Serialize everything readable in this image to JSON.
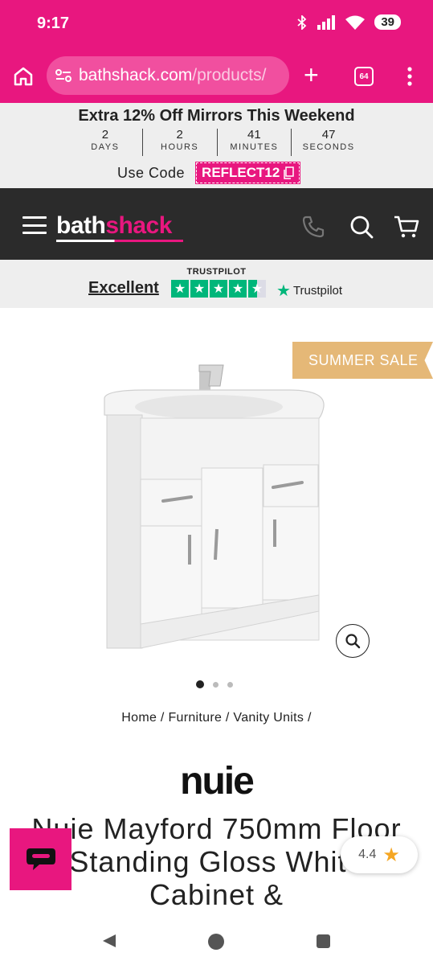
{
  "status_bar": {
    "time": "9:17",
    "battery": "39"
  },
  "browser": {
    "url_domain": "bathshack.com",
    "url_path": "/products/",
    "tab_count": "64"
  },
  "promo": {
    "title": "Extra 12% Off Mirrors This Weekend",
    "countdown": [
      {
        "value": "2",
        "label": "DAYS"
      },
      {
        "value": "2",
        "label": "HOURS"
      },
      {
        "value": "41",
        "label": "MINUTES"
      },
      {
        "value": "47",
        "label": "SECONDS"
      }
    ],
    "code_label": "Use Code",
    "code": "REFLECT12"
  },
  "header": {
    "logo_part1": "bath",
    "logo_part2": "shack"
  },
  "trustpilot": {
    "heading": "TRUSTPILOT",
    "rating_text": "Excellent",
    "brand": "Trustpilot",
    "stars": 4.5
  },
  "product": {
    "badge": "SUMMER SALE",
    "image_count": 3,
    "active_image": 1,
    "breadcrumb": [
      "Home",
      "Furniture",
      "Vanity Units"
    ],
    "brand": "nuie",
    "title": "Nuie Mayford 750mm Floor Standing Gloss White Cabinet &"
  },
  "review_widget": {
    "rating": "4.4"
  }
}
